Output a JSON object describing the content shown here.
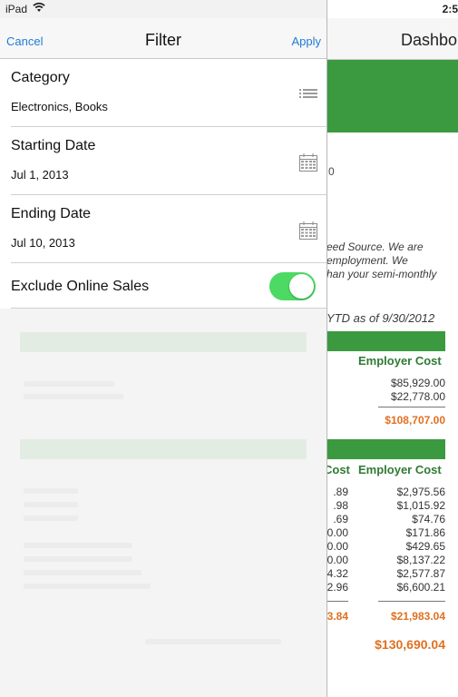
{
  "status": {
    "carrier": "iPad",
    "time": "2:5"
  },
  "filter": {
    "title": "Filter",
    "cancel_label": "Cancel",
    "apply_label": "Apply",
    "category": {
      "label": "Category",
      "value": "Electronics, Books",
      "icon": "list-icon"
    },
    "starting_date": {
      "label": "Starting Date",
      "value": "Jul 1, 2013",
      "icon": "calendar-icon"
    },
    "ending_date": {
      "label": "Ending Date",
      "value": "Jul 10, 2013",
      "icon": "calendar-icon"
    },
    "exclude_online": {
      "label": "Exclude Online Sales",
      "on": true
    }
  },
  "dashboard": {
    "title": "Dashbo",
    "zip_fragment": "0",
    "text_line1": "eed Source. We are",
    "text_line2": "employment.  We",
    "text_line3": "han your semi-monthly",
    "ytd": "YTD as of 9/30/2012",
    "section1": {
      "header": "Employer Cost",
      "values": [
        "$85,929.00",
        "$22,778.00"
      ],
      "total": "$108,707.00"
    },
    "section2": {
      "header_left": "Cost",
      "header_right": "Employer Cost",
      "left_values": [
        ".89",
        ".98",
        ".69",
        "0.00",
        "0.00",
        "0.00",
        "4.32",
        "2.96"
      ],
      "right_values": [
        "$2,975.56",
        "$1,015.92",
        "$74.76",
        "$171.86",
        "$429.65",
        "$8,137.22",
        "$2,577.87",
        "$6,600.21"
      ],
      "left_total": "3.84",
      "right_total": "$21,983.04"
    },
    "grand_total": "$130,690.04",
    "colors": {
      "green": "#3b9a3f",
      "orange": "#e07020"
    }
  }
}
